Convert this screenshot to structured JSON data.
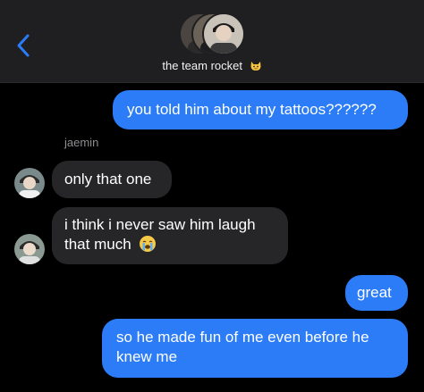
{
  "header": {
    "title": "the team rocket",
    "title_emoji": "cat-face-emoji",
    "back_icon": "chevron-left-icon"
  },
  "messages": [
    {
      "direction": "sent",
      "text": "you told him about my tattoos??????"
    },
    {
      "direction": "received",
      "sender": "jaemin",
      "text": "only that one"
    },
    {
      "direction": "received",
      "text": "i think i never saw him laugh",
      "text2": "that much",
      "emoji": "loudly-crying-face-emoji"
    },
    {
      "direction": "sent",
      "text": "great"
    },
    {
      "direction": "sent",
      "text": "so he made fun of me even before he",
      "text2": "knew me"
    }
  ],
  "colors": {
    "background": "#000000",
    "header": "#1f1f21",
    "sent_bubble": "#2b7cf6",
    "received_bubble": "#262628",
    "accent": "#2b7cf6",
    "sender_name": "#8e8e93"
  }
}
